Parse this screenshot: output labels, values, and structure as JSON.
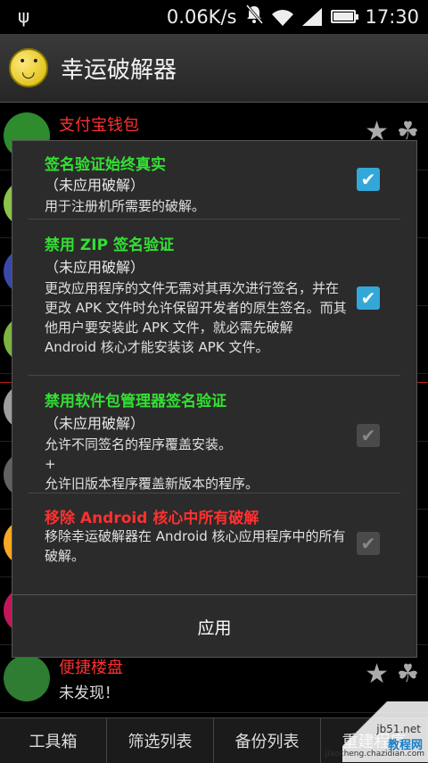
{
  "status_bar": {
    "usb_icon": "usb-icon",
    "speed": "0.06K/s",
    "time": "17:30"
  },
  "app_bar": {
    "title": "幸运破解器"
  },
  "bg_list": [
    {
      "name": "支付宝钱包",
      "status": "",
      "name_color": "#ff3030",
      "avatar_color": "#2e8b2e"
    },
    {
      "name": "",
      "status": "",
      "name_color": "#33e033",
      "avatar_color": "#8bc34a"
    },
    {
      "name": "",
      "status": "",
      "name_color": "#33e033",
      "avatar_color": "#3949ab"
    },
    {
      "name": "",
      "status": "",
      "name_color": "#33e033",
      "avatar_color": "#7cb342"
    },
    {
      "name": "",
      "status": "",
      "name_color": "#33e033",
      "avatar_color": "#9e9e9e"
    },
    {
      "name": "",
      "status": "",
      "name_color": "#33e033",
      "avatar_color": "#616161"
    },
    {
      "name": "",
      "status": "",
      "name_color": "#33e033",
      "avatar_color": "#f9a825"
    },
    {
      "name": "",
      "status": "",
      "name_color": "#33e033",
      "avatar_color": "#c2185b"
    },
    {
      "name": "便捷楼盘",
      "status": "未发现！",
      "name_color": "#ff3030",
      "avatar_color": "#2e7d32"
    }
  ],
  "dialog": {
    "options": [
      {
        "title": "签名验证始终真实",
        "state": "（未应用破解）",
        "desc": "用于注册机所需要的破解。",
        "checked": true
      },
      {
        "title": "禁用 ZIP 签名验证",
        "state": "（未应用破解）",
        "desc": "更改应用程序的文件无需对其再次进行签名，并在更改 APK 文件时允许保留开发者的原生签名。而其他用户要安装此 APK 文件，就必需先破解 Android 核心才能安装该 APK 文件。",
        "checked": true
      },
      {
        "title": "禁用软件包管理器签名验证",
        "state": "（未应用破解）",
        "desc_line1": "允许不同签名的程序覆盖安装。",
        "desc_line2": "+",
        "desc_line3": "允许旧版本程序覆盖新版本的程序。",
        "checked": false
      },
      {
        "title": "移除 Android 核心中所有破解",
        "desc": "移除幸运破解器在 Android 核心应用程序中的所有破解。",
        "checked": false
      }
    ],
    "apply_label": "应用",
    "checkmark": "✔"
  },
  "bottom_tabs": [
    "工具箱",
    "筛选列表",
    "备份列表",
    "重建程序"
  ],
  "watermark": {
    "line1": "jb51.net",
    "line2": "教程网",
    "line3": "jiaocheng.chazidian.com"
  },
  "colors": {
    "accent_green": "#33e033",
    "accent_red": "#ff3030",
    "checkbox_on": "#33a8d8"
  }
}
